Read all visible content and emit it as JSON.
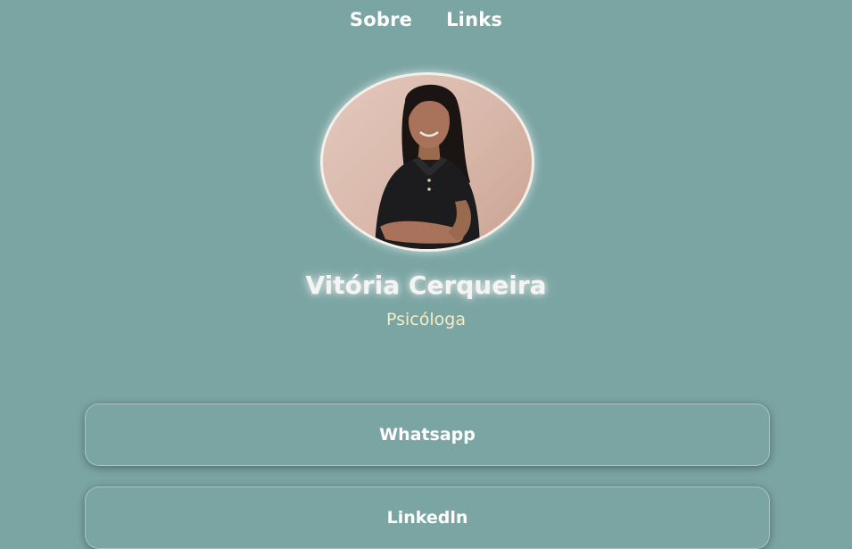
{
  "nav": {
    "items": [
      {
        "label": "Sobre"
      },
      {
        "label": "Links"
      }
    ]
  },
  "profile": {
    "name": "Vitória Cerqueira",
    "role": "Psicóloga"
  },
  "links": [
    {
      "label": "Whatsapp"
    },
    {
      "label": "Linkedln"
    }
  ],
  "colors": {
    "background": "#7ba5a3",
    "text": "#ffffff",
    "role_text": "#f6ecc4"
  }
}
